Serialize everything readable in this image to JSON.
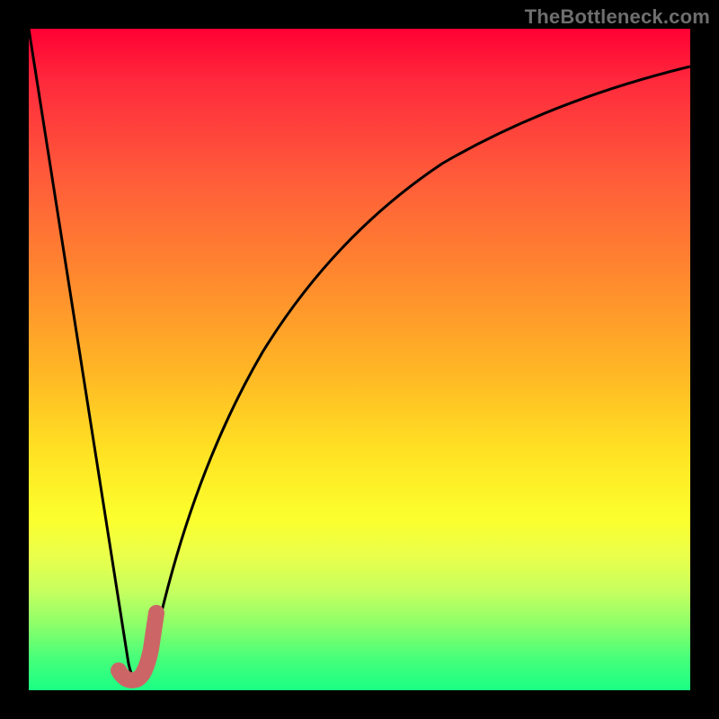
{
  "watermark": {
    "text": "TheBottleneck.com"
  },
  "chart_data": {
    "type": "line",
    "title": "",
    "xlabel": "",
    "ylabel": "",
    "xlim": [
      0,
      100
    ],
    "ylim": [
      0,
      100
    ],
    "series": [
      {
        "name": "bottleneck-curve",
        "x": [
          0,
          2,
          4,
          6,
          8,
          10,
          12,
          14,
          15,
          16,
          18,
          20,
          22,
          25,
          28,
          32,
          36,
          40,
          45,
          50,
          55,
          60,
          65,
          70,
          75,
          80,
          85,
          90,
          95,
          100
        ],
        "y": [
          100,
          88,
          76,
          64,
          52,
          40,
          28,
          14,
          4,
          4,
          14,
          28,
          38,
          50,
          58,
          66,
          72,
          76,
          80,
          83,
          85.5,
          87.5,
          89,
          90.3,
          91.3,
          92.1,
          92.8,
          93.4,
          93.9,
          94.3
        ]
      },
      {
        "name": "highlight-segment",
        "x": [
          14.5,
          15.5,
          16.5,
          17.5
        ],
        "y": [
          3.5,
          3.5,
          6,
          12
        ]
      }
    ],
    "colors": {
      "curve": "#000000",
      "highlight": "#cc6666",
      "gradient_top": "#ff0033",
      "gradient_mid": "#ffe223",
      "gradient_bottom": "#1aff84"
    }
  }
}
